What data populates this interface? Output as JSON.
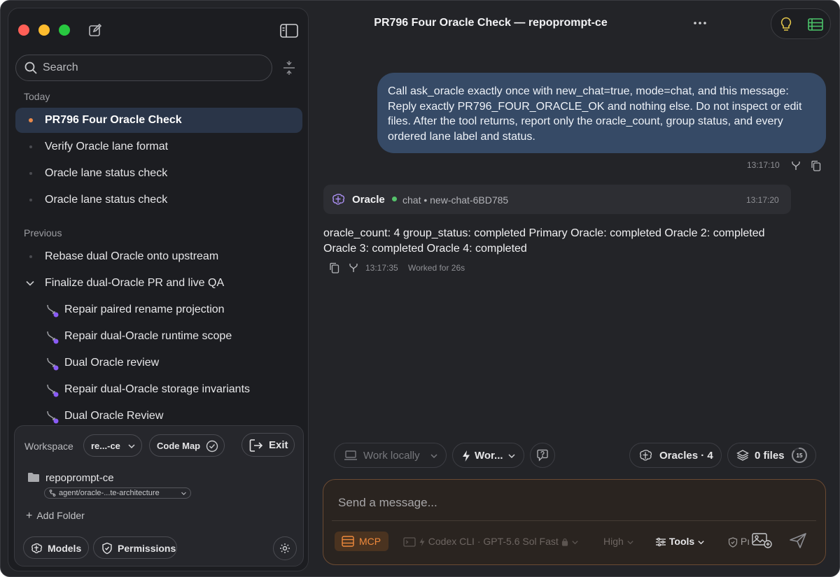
{
  "window": {
    "title": "PR796 Four Oracle Check — repoprompt-ce"
  },
  "sidebar": {
    "search_placeholder": "Search",
    "today_label": "Today",
    "previous_label": "Previous",
    "today_items": [
      {
        "label": "PR796 Four Oracle Check",
        "active": true
      },
      {
        "label": "Verify Oracle lane format"
      },
      {
        "label": "Oracle lane status check"
      },
      {
        "label": "Oracle lane status check"
      }
    ],
    "previous_items": [
      {
        "label": "Rebase dual Oracle onto upstream"
      },
      {
        "label": "Finalize dual-Oracle PR and live QA",
        "expanded": true
      }
    ],
    "sub_items": [
      {
        "label": "Repair paired rename projection"
      },
      {
        "label": "Repair dual-Oracle runtime scope"
      },
      {
        "label": "Dual Oracle review"
      },
      {
        "label": "Repair dual-Oracle storage invariants"
      },
      {
        "label": "Dual Oracle Review"
      }
    ]
  },
  "workspace": {
    "label": "Workspace",
    "selector": "re...-ce",
    "code_map": "Code Map",
    "exit": "Exit",
    "folder": "repoprompt-ce",
    "branch": "agent/oracle-...te-architecture",
    "add_folder": "Add Folder",
    "models": "Models",
    "permissions": "Permissions"
  },
  "messages": {
    "user": {
      "text": "Call ask_oracle exactly once with new_chat=true, mode=chat, and this message: Reply exactly PR796_FOUR_ORACLE_OK and nothing else. Do not inspect or edit files. After the tool returns, report only the oracle_count, group status, and every ordered lane label and status.",
      "time": "13:17:10"
    },
    "oracle": {
      "name": "Oracle",
      "mode": "chat • new-chat-6BD785",
      "time": "13:17:20"
    },
    "assistant": {
      "text": "oracle_count: 4 group_status: completed Primary Oracle: completed Oracle 2: completed Oracle 3: completed Oracle 4: completed",
      "time": "13:17:35",
      "worked": "Worked for 26s"
    }
  },
  "controls": {
    "work_locally": "Work locally",
    "mode": "Wor...",
    "oracles": "Oracles · 4",
    "files": "0 files",
    "files_ring": "15",
    "files_ring_fraction": 0.85
  },
  "composer": {
    "placeholder": "Send a message...",
    "mcp": "MCP",
    "model": "Codex CLI · GPT-5.6 Sol Fast",
    "effort": "High",
    "tools": "Tools",
    "permissions_short": "Pı"
  },
  "colors": {
    "accent_orange": "#e8894b",
    "user_bubble": "#364a66",
    "status_green": "#55c26b",
    "purple": "#8a5cf6"
  }
}
